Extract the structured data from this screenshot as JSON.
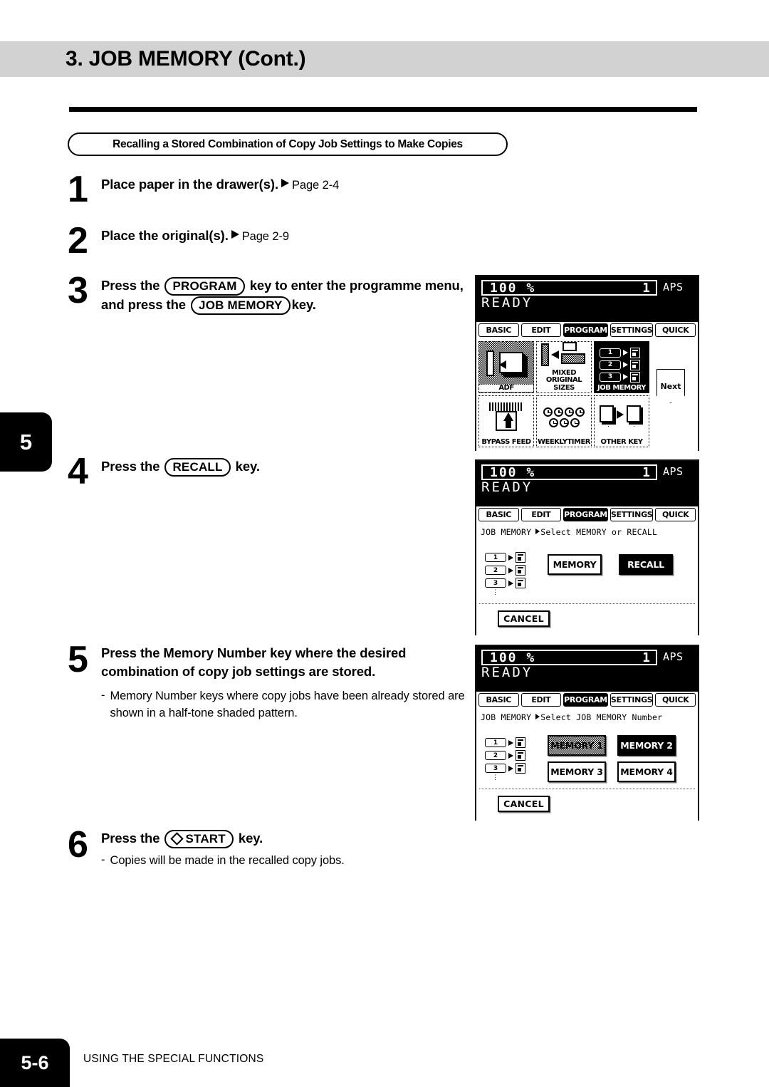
{
  "header": {
    "title": "3. JOB MEMORY (Cont.)"
  },
  "section": {
    "title": "Recalling a Stored Combination of Copy Job Settings to Make Copies"
  },
  "chapter_tab": "5",
  "footer": {
    "page_number": "5-6",
    "running_head": "USING THE SPECIAL FUNCTIONS"
  },
  "steps": [
    {
      "number": "1",
      "text": "Place paper in the drawer(s).",
      "page_ref": "Page 2-4"
    },
    {
      "number": "2",
      "text": "Place the original(s).",
      "page_ref": "Page 2-9"
    },
    {
      "number": "3",
      "text_a": "Press the",
      "key_a": "PROGRAM",
      "text_b": "key to enter the programme menu, and  press the",
      "key_b": "JOB MEMORY",
      "text_c": "key."
    },
    {
      "number": "4",
      "text_a": "Press the",
      "key_a": "RECALL",
      "text_c": "key."
    },
    {
      "number": "5",
      "text": "Press the Memory Number key where the desired combination of copy job settings are stored.",
      "note_dash": "-",
      "note": "Memory Number keys where copy jobs have been already stored are shown in a half-tone shaded pattern."
    },
    {
      "number": "6",
      "text_a": "Press the",
      "key_a": "START",
      "key_a_icon": "start-diamond-icon",
      "text_c": "key.",
      "note_dash": "-",
      "note": "Copies will be made in the recalled copy jobs."
    }
  ],
  "lcd_common": {
    "ratio": "100  %",
    "percent_symbol": "%",
    "copy_count": "1",
    "paper_mode": "APS",
    "status": "READY",
    "tabs": [
      {
        "label": "BASIC",
        "selected": false
      },
      {
        "label": "EDIT",
        "selected": false
      },
      {
        "label": "PROGRAM",
        "selected": true
      },
      {
        "label": "SETTINGS",
        "selected": false
      },
      {
        "label": "QUICK",
        "selected": false
      }
    ]
  },
  "panel1": {
    "function_keys": [
      {
        "label": "ADF",
        "state": "shaded",
        "art": "adf-icon"
      },
      {
        "label": "MIXED\nORIGINAL SIZES",
        "label_line1": "MIXED",
        "label_line2": "ORIGINAL SIZES",
        "state": "normal",
        "art": "mixed-original-sizes-icon"
      },
      {
        "label": "JOB MEMORY",
        "state": "selected",
        "art": "job-memory-icon"
      },
      {
        "label": "BYPASS FEED",
        "state": "normal",
        "art": "bypass-feed-icon"
      },
      {
        "label": "WEEKLYTIMER",
        "state": "normal",
        "art": "weekly-timer-icon"
      },
      {
        "label": "OTHER KEY",
        "state": "normal",
        "art": "other-key-icon"
      }
    ],
    "next_key": "Next"
  },
  "panel2": {
    "status_prefix": "JOB MEMORY",
    "status_text": "Select MEMORY or RECALL",
    "buttons": [
      {
        "label": "MEMORY",
        "state": "normal"
      },
      {
        "label": "RECALL",
        "state": "inverse"
      }
    ],
    "cancel": "CANCEL",
    "job_memory_rows": [
      "1",
      "2",
      "3"
    ]
  },
  "panel3": {
    "status_prefix": "JOB MEMORY",
    "status_text": "Select JOB MEMORY Number",
    "buttons": [
      {
        "label": "MEMORY 1",
        "state": "shaded"
      },
      {
        "label": "MEMORY 2",
        "state": "inverse"
      },
      {
        "label": "MEMORY 3",
        "state": "normal"
      },
      {
        "label": "MEMORY 4",
        "state": "normal"
      }
    ],
    "cancel": "CANCEL",
    "job_memory_rows": [
      "1",
      "2",
      "3"
    ]
  }
}
